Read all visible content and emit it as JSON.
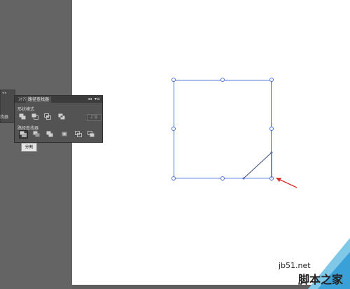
{
  "panel": {
    "tabs": [
      {
        "label": "对齐"
      },
      {
        "label": "路径查找器"
      }
    ],
    "collapse_glyph": "◂◂",
    "menu_glyph": "▾≡",
    "shape_modes_label": "形状模式",
    "pathfinders_label": "路径查找器",
    "expand_label": "扩展",
    "shape_mode_icons": [
      "unite-icon",
      "minus-front-icon",
      "intersect-icon",
      "exclude-icon"
    ],
    "pathfinder_icons": [
      "divide-icon",
      "trim-icon",
      "merge-icon",
      "crop-icon",
      "outline-icon",
      "minus-back-icon"
    ]
  },
  "side_tab": {
    "label": "找器",
    "grip": "◂◂"
  },
  "tooltip": {
    "label": "分割"
  },
  "watermark": {
    "site": "jb51.net",
    "name": "脚本之家"
  },
  "colors": {
    "selection": "#4f6fe0",
    "arrow": "#e03030",
    "path": "#3a4a7a",
    "panel_bg": "#535353"
  }
}
